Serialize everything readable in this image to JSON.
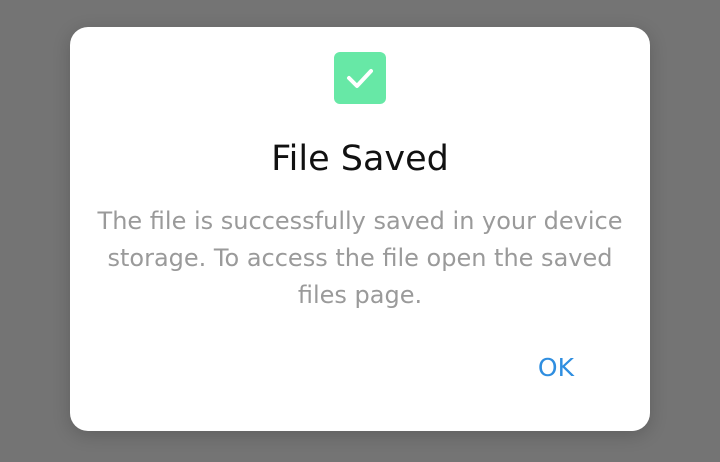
{
  "colors": {
    "overlay": "#747474",
    "dialog_background": "#ffffff",
    "check_badge": "#67e8a6",
    "title": "#111111",
    "message": "#9a9a9a",
    "accent": "#2f8ee0"
  },
  "dialog": {
    "icon": "check-icon",
    "title": "File Saved",
    "message": "The file is successfully saved in your device storage. To access the file open the saved files page.",
    "ok_label": "OK"
  }
}
